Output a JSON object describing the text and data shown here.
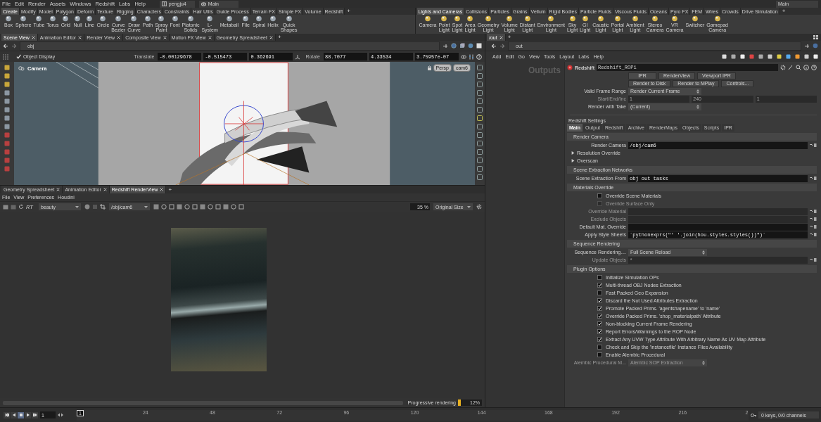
{
  "menubar": {
    "items": [
      "File",
      "Edit",
      "Render",
      "Assets",
      "Windows",
      "Redshift",
      "Labs",
      "Help"
    ],
    "desktop": "pengju4",
    "context": "Main",
    "desktop_right": "Main"
  },
  "shelves": [
    {
      "tabs": [
        {
          "label": "Create",
          "selected": true
        },
        {
          "label": "Modify",
          "selected": false
        },
        {
          "label": "Model",
          "selected": false
        },
        {
          "label": "Polygon",
          "selected": false
        },
        {
          "label": "Deform",
          "selected": false
        },
        {
          "label": "Texture",
          "selected": false
        },
        {
          "label": "Rigging",
          "selected": false
        },
        {
          "label": "Characters",
          "selected": false
        },
        {
          "label": "Constraints",
          "selected": false
        },
        {
          "label": "Hair Utils",
          "selected": false
        },
        {
          "label": "Guide Process",
          "selected": false
        },
        {
          "label": "Terrain FX",
          "selected": false
        },
        {
          "label": "Simple FX",
          "selected": false
        },
        {
          "label": "Volume",
          "selected": false
        },
        {
          "label": "Redshift",
          "selected": false
        }
      ],
      "new_tab": "+",
      "tools": [
        "Box",
        "Sphere",
        "Tube",
        "Torus",
        "Grid",
        "Null",
        "Line",
        "Circle",
        "Curve Bezier",
        "Draw Curve",
        "Path",
        "Spray Paint",
        "Font",
        "Platonic Solids",
        "L-System",
        "Metaball",
        "File",
        "Spiral",
        "Helix",
        "Quick Shapes"
      ]
    },
    {
      "tabs": [
        {
          "label": "Lights and Cameras",
          "selected": true
        },
        {
          "label": "Collisions",
          "selected": false
        },
        {
          "label": "Particles",
          "selected": false
        },
        {
          "label": "Grains",
          "selected": false
        },
        {
          "label": "Vellum",
          "selected": false
        },
        {
          "label": "Rigid Bodies",
          "selected": false
        },
        {
          "label": "Particle Fluids",
          "selected": false
        },
        {
          "label": "Viscous Fluids",
          "selected": false
        },
        {
          "label": "Oceans",
          "selected": false
        },
        {
          "label": "Pyro FX",
          "selected": false
        },
        {
          "label": "FEM",
          "selected": false
        },
        {
          "label": "Wires",
          "selected": false
        },
        {
          "label": "Crowds",
          "selected": false
        },
        {
          "label": "Drive Simulation",
          "selected": false
        }
      ],
      "new_tab": "+",
      "tools": [
        "Camera",
        "Point Light",
        "Spot Light",
        "Area Light",
        "Geometry Light",
        "Volume Light",
        "Distant Light",
        "Environment Light",
        "Sky Light",
        "GI Light",
        "Caustic Light",
        "Portal Light",
        "Ambient Light",
        "Stereo Camera",
        "VR Camera",
        "Switcher",
        "Gamepad Camera"
      ]
    }
  ],
  "scene_view": {
    "tabs": [
      {
        "label": "Scene View",
        "selected": true
      },
      {
        "label": "Animation Editor",
        "selected": false
      },
      {
        "label": "Render View",
        "selected": false
      },
      {
        "label": "Composite View",
        "selected": false
      },
      {
        "label": "Motion FX View",
        "selected": false
      },
      {
        "label": "Geometry Spreadsheet",
        "selected": false
      }
    ],
    "new_tab": "+",
    "path": "obj",
    "object_display": {
      "label": "Object Display",
      "checked": true
    },
    "translate": {
      "label": "Translate",
      "values": [
        "-0.00129678",
        "-0.515473",
        "0.362691"
      ]
    },
    "rotate": {
      "label": "Rotate",
      "values": [
        "88.7077",
        "4.33534",
        "3.75957e-07"
      ]
    },
    "viewport": {
      "camera_label": "Camera",
      "projection": "Persp",
      "camera": "cam6"
    }
  },
  "render_view": {
    "tabs": [
      {
        "label": "Geometry Spreadsheet",
        "selected": false
      },
      {
        "label": "Animation Editor",
        "selected": false
      },
      {
        "label": "Redshift RenderView",
        "selected": true
      }
    ],
    "new_tab": "+",
    "menu": [
      "File",
      "View",
      "Preferences",
      "Houdini"
    ],
    "toolbar": {
      "rt": "RT",
      "aov": "beauty",
      "camera": "/obj/cam6",
      "zoom": "35 %",
      "size": "Original Size"
    },
    "progress": {
      "label": "Progressive rendering",
      "level": 0.12,
      "reading": "12%"
    }
  },
  "network": {
    "tabs": [
      {
        "label": "/out",
        "selected": true
      }
    ],
    "new_tab": "+",
    "path": "out",
    "menu": [
      "Add",
      "Edit",
      "Go",
      "View",
      "Tools",
      "Layout",
      "Labs",
      "Help"
    ],
    "title": "Outputs"
  },
  "parameters": {
    "node_type": "Redshift",
    "node_name": "Redshift_ROP1",
    "top_rows": [
      {
        "kind": "buttons",
        "labels": [
          "IPR",
          "RenderView",
          "Viewport IPR"
        ]
      },
      {
        "kind": "buttons",
        "labels": [
          "Render to Disk",
          "Render to MPlay",
          "Controls..."
        ]
      },
      {
        "kind": "dropdown",
        "label": "Valid Frame Range",
        "value": "Render Current Frame",
        "disabled": false
      },
      {
        "kind": "multi",
        "label": "Start/End/Inc",
        "values": [
          "1",
          "240",
          "1"
        ],
        "disabled": true
      },
      {
        "kind": "dropdown",
        "label": "Render with Take",
        "value": "(Current)",
        "disabled": false
      }
    ],
    "settings_label": "Redshift Settings",
    "tabs": [
      {
        "label": "Main",
        "selected": true
      },
      {
        "label": "Output",
        "selected": false
      },
      {
        "label": "Redshift",
        "selected": false
      },
      {
        "label": "Archive",
        "selected": false
      },
      {
        "label": "RenderMaps",
        "selected": false
      },
      {
        "label": "Objects",
        "selected": false
      },
      {
        "label": "Scripts",
        "selected": false
      },
      {
        "label": "IPR",
        "selected": false
      }
    ],
    "rows": [
      {
        "kind": "heading",
        "label": "Render Camera"
      },
      {
        "kind": "field",
        "label": "Render Camera",
        "value": "/obj/cam6",
        "disabled": false
      },
      {
        "kind": "folder",
        "label": "Resolution Override",
        "expanded": false
      },
      {
        "kind": "folder",
        "label": "Overscan",
        "expanded": false
      },
      {
        "kind": "heading",
        "label": "Scene Extraction Networks"
      },
      {
        "kind": "field",
        "label": "Scene Extraction From",
        "value": "obj out tasks",
        "disabled": false
      },
      {
        "kind": "heading",
        "label": "Materials Override"
      },
      {
        "kind": "checkbox",
        "label": "Override Scene Materials",
        "checked": false,
        "disabled": false
      },
      {
        "kind": "checkbox",
        "label": "Override Surface Only",
        "checked": false,
        "disabled": true
      },
      {
        "kind": "field",
        "label": "Override Material",
        "disabled": true
      },
      {
        "kind": "field",
        "label": "Exclude Objects",
        "disabled": true
      },
      {
        "kind": "field",
        "label": "Default Mat. Override",
        "disabled": false
      },
      {
        "kind": "field",
        "label": "Apply Style Sheets",
        "value": "`pythonexprs(\"' '.join(hou.styles.styles())\")`",
        "disabled": false
      },
      {
        "kind": "heading",
        "label": "Sequence Rendering"
      },
      {
        "kind": "dropdown",
        "label": "Sequence Rendering....",
        "value": "Full Scene Reload",
        "disabled": false
      },
      {
        "kind": "field",
        "label": "Update Objects",
        "value": "*",
        "disabled": true
      },
      {
        "kind": "heading",
        "label": "Plugin Options"
      },
      {
        "kind": "checkbox",
        "label": "Initialize Simulation OPs",
        "checked": false,
        "disabled": false
      },
      {
        "kind": "checkbox",
        "label": "Multi-thread OBJ Nodes Extraction",
        "checked": true,
        "disabled": false
      },
      {
        "kind": "checkbox",
        "label": "Fast Packed Geo Expansion",
        "checked": false,
        "disabled": false
      },
      {
        "kind": "checkbox",
        "label": "Discard the Not Used Attributes Extraction",
        "checked": true,
        "disabled": false
      },
      {
        "kind": "checkbox",
        "label": "Promote Packed Prims. 'agentshapename' to 'name'",
        "checked": true,
        "disabled": false
      },
      {
        "kind": "checkbox",
        "label": "Override Packed Prims. 'shop_materialpath' Attribute",
        "checked": true,
        "disabled": false
      },
      {
        "kind": "checkbox",
        "label": "Non-blocking Current Frame Rendering",
        "checked": true,
        "disabled": false
      },
      {
        "kind": "checkbox",
        "label": "Report Errors/Warnings to the ROP Node",
        "checked": true,
        "disabled": false
      },
      {
        "kind": "checkbox",
        "label": "Extract Any UVW Type Attribute With Arbitrary Name As UV Map Attribute",
        "checked": true,
        "disabled": false
      },
      {
        "kind": "checkbox",
        "label": "Check and Skip the 'instancefile' Instance Files Availability",
        "checked": false,
        "disabled": false
      },
      {
        "kind": "checkbox",
        "label": "Enable Alembic Procedural",
        "checked": false,
        "disabled": false
      },
      {
        "kind": "dropdown",
        "label": "Alembic Procedural M...",
        "value": "Alembic SOP Extraction",
        "disabled": true
      }
    ]
  },
  "timeline": {
    "frame": "1",
    "start_marker": "1",
    "ticks": [
      "24",
      "48",
      "72",
      "96",
      "120",
      "144",
      "168",
      "192",
      "216",
      "2"
    ],
    "status": "0 keys, 0/0 channels"
  }
}
